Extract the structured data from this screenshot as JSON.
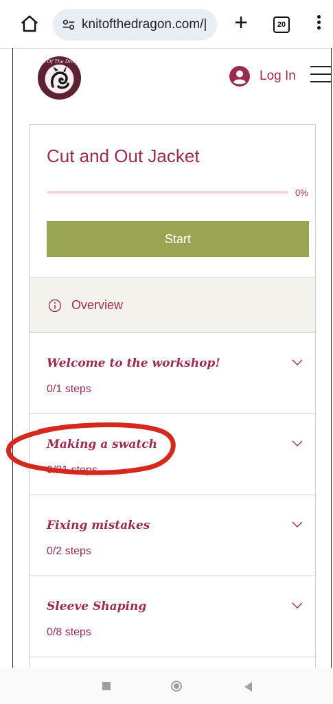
{
  "browser": {
    "url": "knitofthedragon.com/|",
    "tab_count": "20"
  },
  "site": {
    "logo_text": "Knit Of The Dragon",
    "login_label": "Log In"
  },
  "course": {
    "title": "Cut and Out Jacket",
    "progress": 0,
    "progress_label": "0%",
    "start_label": "Start",
    "overview_label": "Overview",
    "sections": [
      {
        "name": "Welcome to the workshop!",
        "steps": "0/1 steps"
      },
      {
        "name": "Making a swatch",
        "steps": "0/21 steps"
      },
      {
        "name": "Fixing mistakes",
        "steps": "0/2 steps"
      },
      {
        "name": "Sleeve Shaping",
        "steps": "0/8 steps"
      }
    ]
  },
  "colors": {
    "brand": "#9b2c4f",
    "start_button": "#9aa554",
    "overview_bg": "#f3f2ec",
    "annotation": "#d42a1e"
  },
  "icons": [
    "home-icon",
    "site-settings-icon",
    "new-tab-icon",
    "tab-switcher-icon",
    "overflow-menu-icon",
    "user-avatar-icon",
    "hamburger-menu-icon",
    "info-icon",
    "chevron-down-icon"
  ]
}
